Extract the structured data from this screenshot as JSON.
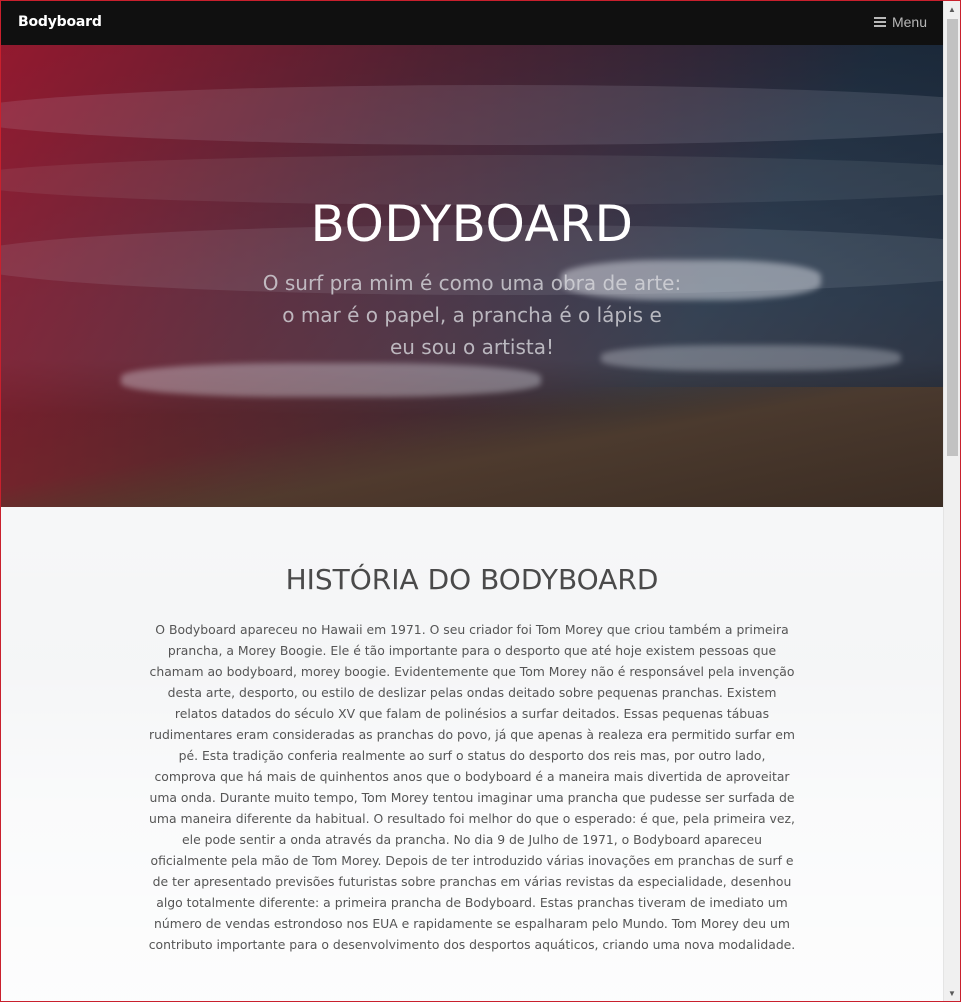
{
  "navbar": {
    "brand": "Bodyboard",
    "menu_label": "Menu",
    "menu_icon": "hamburger-icon"
  },
  "hero": {
    "title": "BODYBOARD",
    "subtitle_lines": [
      "O surf pra mim é como uma obra de arte:",
      "o mar é o papel, a prancha é o lápis e",
      "eu sou o artista!"
    ]
  },
  "about": {
    "title": "HISTÓRIA DO BODYBOARD",
    "text": "O Bodyboard apareceu no Hawaii em 1971. O seu criador foi Tom Morey que criou também a primeira prancha, a Morey Boogie. Ele é tão importante para o desporto que até hoje existem pessoas que chamam ao bodyboard, morey boogie. Evidentemente que Tom Morey não é responsável pela invenção desta arte, desporto, ou estilo de deslizar pelas ondas deitado sobre pequenas pranchas. Existem relatos datados do século XV que falam de polinésios a surfar deitados. Essas pequenas tábuas rudimentares eram consideradas as pranchas do povo, já que apenas à realeza era permitido surfar em pé. Esta tradição conferia realmente ao surf o status do desporto dos reis mas, por outro lado, comprova que há mais de quinhentos anos que o bodyboard é a maneira mais divertida de aproveitar uma onda. Durante muito tempo, Tom Morey tentou imaginar uma prancha que pudesse ser surfada de uma maneira diferente da habitual. O resultado foi melhor do que o esperado: é que, pela primeira vez, ele pode sentir a onda através da prancha. No dia 9 de Julho de 1971, o Bodyboard apareceu oficialmente pela mão de Tom Morey. Depois de ter introduzido várias inovações em pranchas de surf e de ter apresentado previsões futuristas sobre pranchas em várias revistas da especialidade, desenhou algo totalmente diferente: a primeira prancha de Bodyboard. Estas pranchas tiveram de imediato um número de vendas estrondoso nos EUA e rapidamente se espalharam pelo Mundo. Tom Morey deu um contributo importante para o desenvolvimento dos desportos aquáticos, criando uma nova modalidade."
  },
  "scrollbar": {
    "up_icon": "chevron-up-icon",
    "down_icon": "chevron-down-icon"
  },
  "colors": {
    "navbar_bg": "#101010",
    "accent_red": "#c9202d",
    "hero_title": "#ffffff",
    "body_text": "#555555"
  }
}
